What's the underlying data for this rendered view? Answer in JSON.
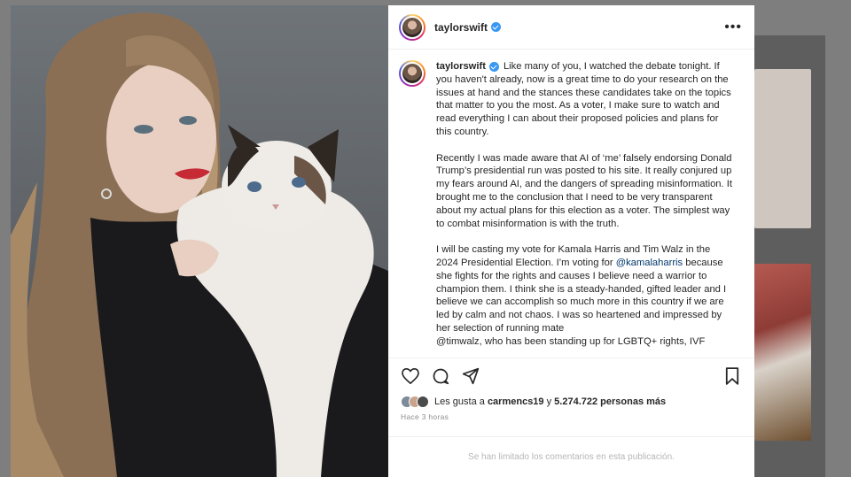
{
  "post": {
    "username": "taylorswift",
    "more_label": "•••",
    "caption": {
      "username": "taylorswift",
      "p1": "Like many of you, I watched the debate tonight. If you haven't already, now is a great time to do your research on the issues at hand and the stances these candidates take on the topics that matter to you the most. As a voter, I make sure to watch and read everything I can about their proposed policies and plans for this country.",
      "p2": "Recently I was made aware that AI of ‘me’ falsely endorsing Donald Trump’s presidential run was posted to his site. It really conjured up my fears around AI, and the dangers of spreading misinformation. It brought me to the conclusion that I need to be very transparent about my actual plans for this election as a voter. The simplest way to combat misinformation is with the truth.",
      "p3_a": "I will be casting my vote for Kamala Harris and Tim Walz in the 2024 Presidential Election. I’m voting for ",
      "p3_mention": "@kamalaharris",
      "p3_b": " because she fights for the rights and causes I believe need a warrior to champion them. I think she is a steady-handed, gifted leader and I believe we can accomplish so much more in this country if we are led by calm and not chaos. I was so heartened and impressed by her selection of running mate",
      "p3_c": "@timwalz, who has been standing up for LGBTQ+ rights, IVF"
    },
    "likes": {
      "prefix": "Les gusta a",
      "user": "carmencs19",
      "joiner": "y",
      "count": "5.274.722 personas más"
    },
    "timestamp": "Hace 3 horas",
    "comments_note": "Se han limitado los comentarios en esta publicación."
  },
  "icons": {
    "like": "heart-icon",
    "comment": "comment-icon",
    "share": "send-icon",
    "save": "bookmark-icon",
    "verified": "verified-badge-icon"
  },
  "colors": {
    "verified": "#3897f0",
    "mention": "#00376b",
    "muted": "#8e8e8e"
  }
}
